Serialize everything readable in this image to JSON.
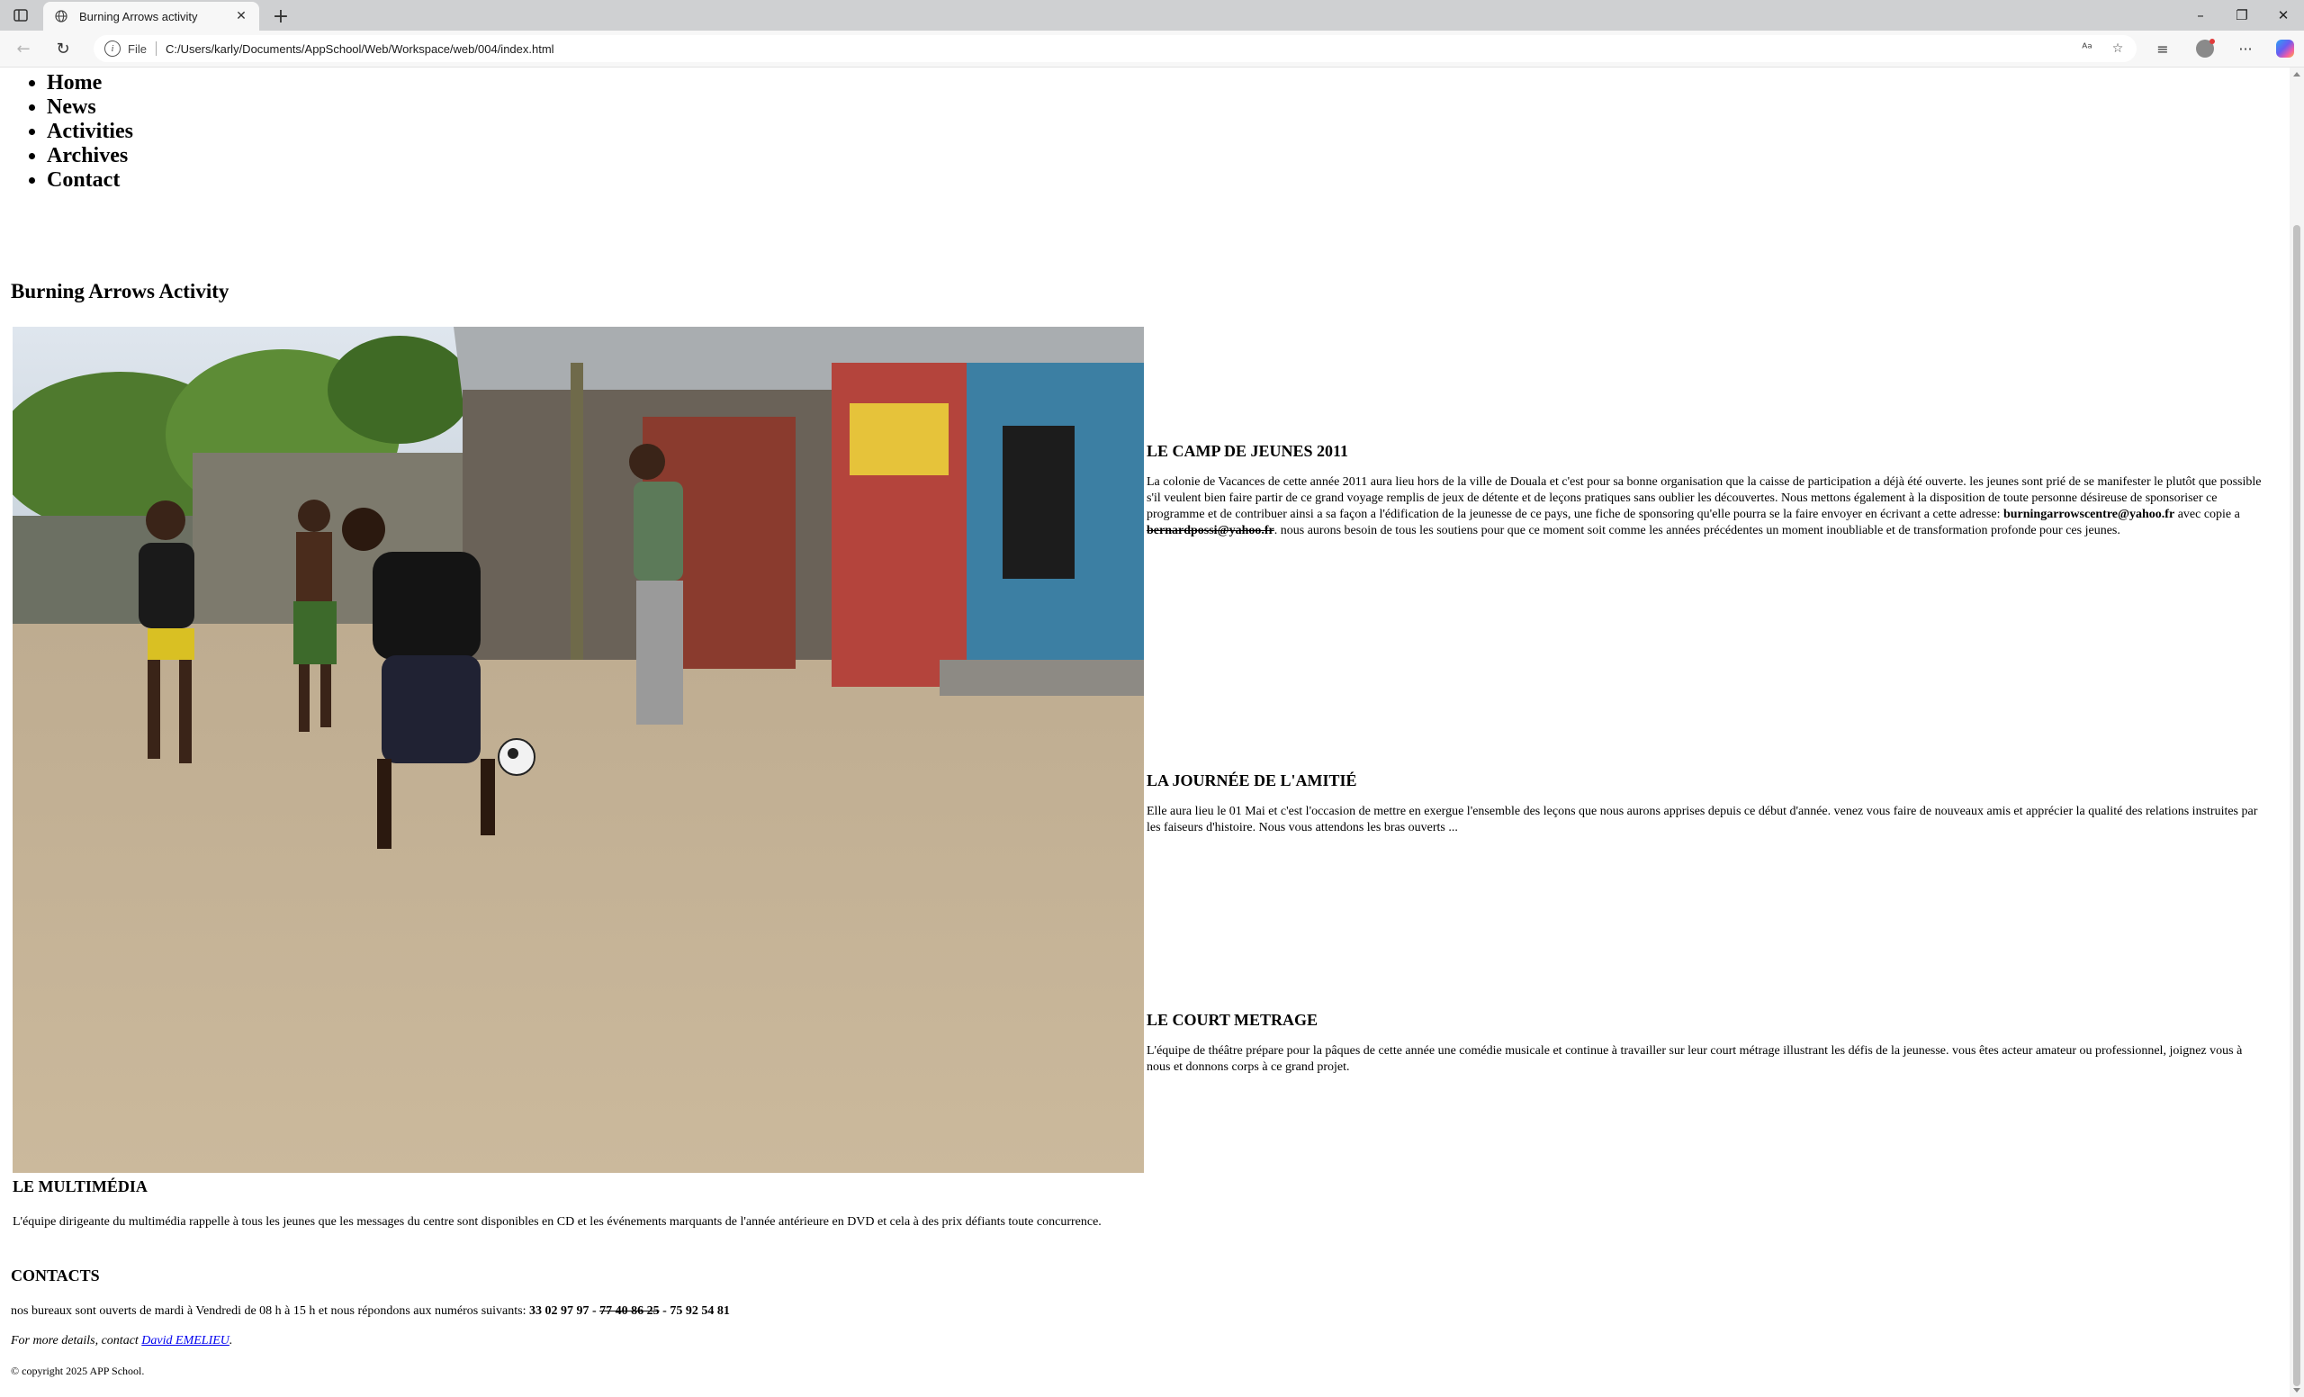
{
  "browser": {
    "tab_title": "Burning Arrows activity",
    "address_label": "File",
    "url": "C:/Users/karly/Documents/AppSchool/Web/Workspace/web/004/index.html"
  },
  "nav": {
    "items": [
      {
        "label": "Home"
      },
      {
        "label": "News"
      },
      {
        "label": "Activities"
      },
      {
        "label": "Archives"
      },
      {
        "label": "Contact"
      }
    ]
  },
  "page": {
    "title": "Burning Arrows Activity",
    "image_alt": "Boys playing street football"
  },
  "sections": {
    "camp": {
      "heading": "LE CAMP DE JEUNES 2011",
      "text_before": "La colonie de Vacances de cette année 2011 aura lieu hors de la ville de Douala et c'est pour sa bonne organisation que la caisse de participation a déjà été ouverte. les jeunes sont prié de se manifester le plutôt que possible s'il veulent bien faire partir de ce grand voyage remplis de jeux de détente et de leçons pratiques sans oublier les découvertes. Nous mettons également à la disposition de toute personne désireuse de sponsoriser ce programme et de contribuer ainsi a sa façon a l'édification de la jeunesse de ce pays, une fiche de sponsoring qu'elle pourra se la faire envoyer en écrivant a cette adresse: ",
      "email_main": "burningarrowscentre@yahoo.fr",
      "text_middle": " avec copie a ",
      "email_copy": "bernardpossi@yahoo.fr",
      "text_after": ". nous aurons besoin de tous les soutiens pour que ce moment soit comme les années précédentes un moment inoubliable et de transformation profonde pour ces jeunes."
    },
    "amitie": {
      "heading": "LA JOURNÉE DE L'AMITIÉ",
      "text": "Elle aura lieu le 01 Mai et c'est l'occasion de mettre en exergue l'ensemble des leçons que nous aurons apprises depuis ce début d'année. venez vous faire de nouveaux amis et apprécier la qualité des relations instruites par les faiseurs d'histoire. Nous vous attendons les bras ouverts ..."
    },
    "court": {
      "heading": "LE COURT METRAGE",
      "text": "L'équipe de théâtre prépare pour la pâques de cette année une comédie musicale et continue à travailler sur leur court métrage illustrant les défis de la jeunesse. vous êtes acteur amateur ou professionnel, joignez vous à nous et donnons corps à ce grand projet."
    },
    "multimedia": {
      "heading": "LE MULTIMÉDIA",
      "text": "L'équipe dirigeante du multimédia rappelle à tous les jeunes que les messages du centre sont disponibles en CD et les événements marquants de l'année antérieure en DVD et cela à des prix défiants toute concurrence."
    },
    "contacts": {
      "heading": "CONTACTS",
      "text": "nos bureaux sont ouverts de mardi à Vendredi de 08 h à 15 h et nous répondons aux numéros suivants: ",
      "phone1": "33 02 97 97",
      "dash1": " - ",
      "phone2": "77 40 86 25",
      "dash2": " - ",
      "phone3": "75 92 54 81"
    }
  },
  "footer": {
    "details_prefix": "For more details, contact ",
    "details_link": "David EMELIEU",
    "details_suffix": ".",
    "copyright": "© copyright 2025 APP School."
  }
}
